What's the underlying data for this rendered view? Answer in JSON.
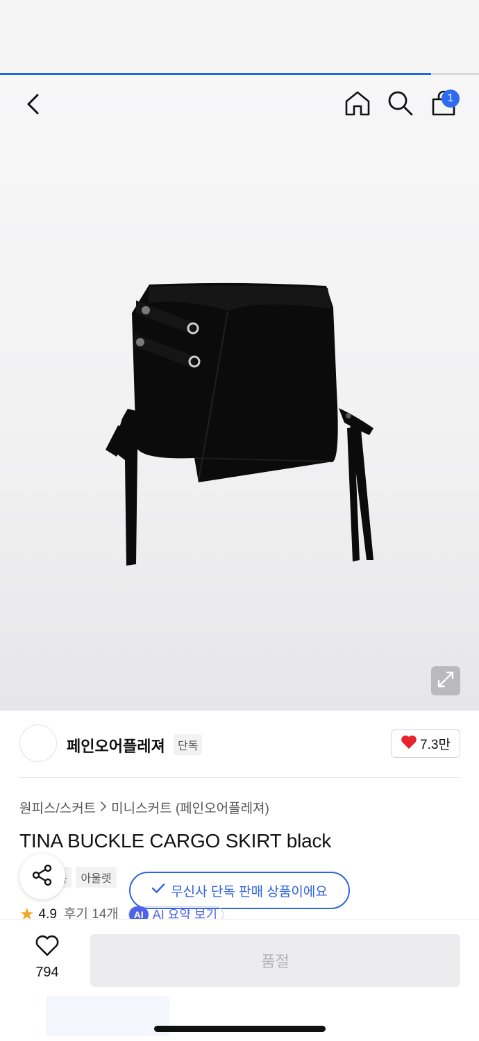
{
  "progress": {
    "fraction": 0.9
  },
  "cart": {
    "badge_count": "1"
  },
  "icons": {
    "back": "chevron-left-icon",
    "home": "home-icon",
    "search": "search-icon",
    "cart": "shopping-bag-icon",
    "expand": "expand-icon",
    "share": "share-icon",
    "heart": "heart-icon",
    "check": "check-icon",
    "star": "star-icon"
  },
  "colors": {
    "accent": "#2e6bf0",
    "toast": "#2f63e0",
    "heart": "#e8212f",
    "ai": "#4f63e6",
    "star": "#f5a623"
  },
  "brand": {
    "name": "페인오어플레져",
    "tag": "단독",
    "like_count": "7.3만"
  },
  "breadcrumb": {
    "category": "원피스/스커트",
    "subcategory": "미니스커트 (페인오어플레져)"
  },
  "product": {
    "title": "TINA BUCKLE CARGO SKIRT black",
    "tags": [
      "단독",
      "아울렛"
    ]
  },
  "toast": {
    "text": "무신사 단독 판매 상품이에요"
  },
  "rating": {
    "score": "4.9",
    "reviews": "후기 14개",
    "ai_badge": "AI",
    "ai_label": "AI 요약 보기"
  },
  "bottom": {
    "wish_count": "794",
    "buy_label": "품절"
  }
}
